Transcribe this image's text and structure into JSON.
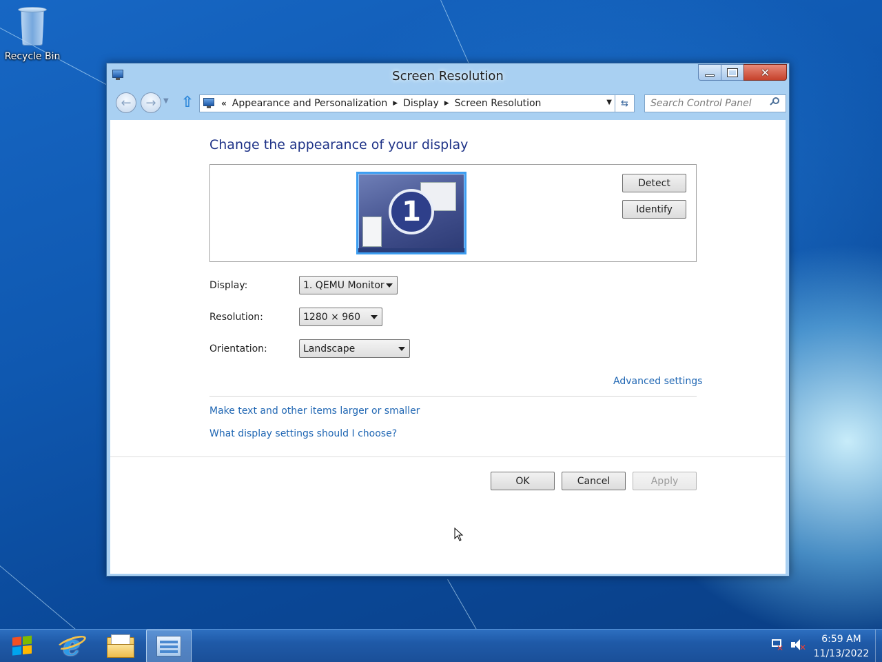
{
  "desktop": {
    "recycle_bin_label": "Recycle Bin"
  },
  "window": {
    "title": "Screen Resolution",
    "address": {
      "overflow": "«",
      "crumbs": [
        "Appearance and Personalization",
        "Display",
        "Screen Resolution"
      ]
    },
    "search": {
      "placeholder": "Search Control Panel"
    },
    "heading": "Change the appearance of your display",
    "monitor_number": "1",
    "buttons": {
      "detect": "Detect",
      "identify": "Identify",
      "ok": "OK",
      "cancel": "Cancel",
      "apply": "Apply"
    },
    "fields": {
      "display_label": "Display:",
      "display_value": "1. QEMU Monitor",
      "resolution_label": "Resolution:",
      "resolution_value": "1280 × 960",
      "orientation_label": "Orientation:",
      "orientation_value": "Landscape"
    },
    "links": {
      "advanced_settings": "Advanced settings",
      "text_size": "Make text and other items larger or smaller",
      "display_help": "What display settings should I choose?"
    }
  },
  "taskbar": {
    "clock_time": "6:59 AM",
    "clock_date": "11/13/2022"
  },
  "colors": {
    "link": "#1f66b3",
    "heading": "#1e3287",
    "close_button": "#c6412b",
    "desktop": "#0f58b0"
  }
}
